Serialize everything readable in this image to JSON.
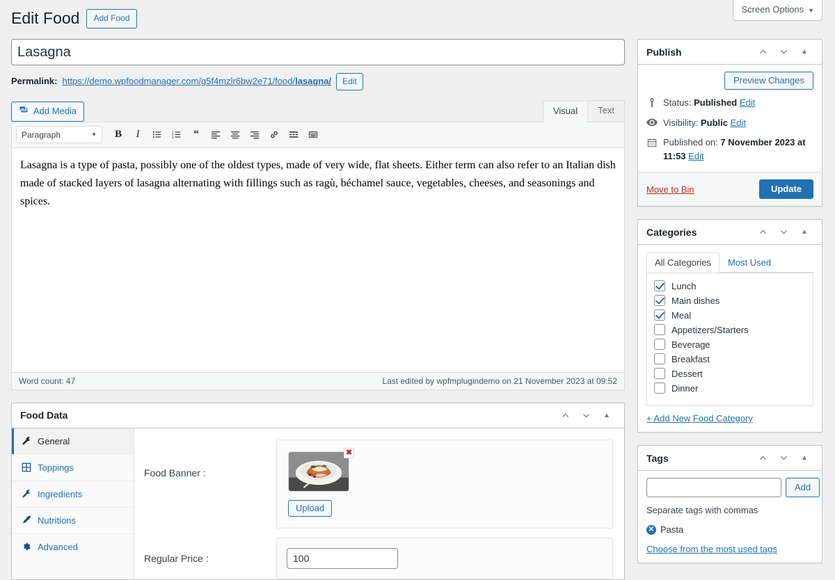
{
  "screen_meta": {
    "screen_options_label": "Screen Options",
    "caret": "▼"
  },
  "header": {
    "page_title": "Edit Food",
    "add_new_label": "Add Food"
  },
  "post": {
    "title_value": "Lasagna",
    "title_placeholder": "Add title",
    "permalink_label": "Permalink:",
    "permalink_base": "https://demo.wpfoodmanager.com/g5f4mzlr6bw2e71/food/",
    "permalink_slug": "lasagna/",
    "permalink_edit_label": "Edit"
  },
  "editor": {
    "add_media_label": "Add Media",
    "tabs": [
      {
        "label": "Visual",
        "active": true
      },
      {
        "label": "Text",
        "active": false
      }
    ],
    "format_select": "Paragraph",
    "toolbar_icons": [
      "bold-icon",
      "italic-icon",
      "bulleted-list-icon",
      "numbered-list-icon",
      "blockquote-icon",
      "align-left-icon",
      "align-center-icon",
      "align-right-icon",
      "link-icon",
      "read-more-icon",
      "toolbar-toggle-icon"
    ],
    "content_paragraph": "Lasagna is a type of pasta, possibly one of the oldest types, made of very wide, flat sheets. Either term can also refer to an Italian dish made of stacked layers of lasagna alternating with fillings such as ragù, béchamel sauce, vegetables, cheeses, and seasonings and spices.",
    "word_count": "Word count: 47",
    "last_edited": "Last edited by wpfmplugindemo on 21 November 2023 at 09:52"
  },
  "food_data": {
    "panel_title": "Food Data",
    "tabs": [
      {
        "label": "General",
        "icon": "wrench-icon",
        "active": true
      },
      {
        "label": "Toppings",
        "icon": "grid-icon",
        "active": false
      },
      {
        "label": "Ingredients",
        "icon": "wrench-icon",
        "active": false
      },
      {
        "label": "Nutritions",
        "icon": "syringe-icon",
        "active": false
      },
      {
        "label": "Advanced",
        "icon": "gear-icon",
        "active": false
      }
    ],
    "banner_label": "Food Banner :",
    "banner_remove_glyph": "✖",
    "upload_label": "Upload",
    "price_label": "Regular Price :",
    "price_value": "100"
  },
  "publish": {
    "panel_title": "Publish",
    "preview_label": "Preview Changes",
    "status_label": "Status:",
    "status_value": "Published",
    "status_edit": "Edit",
    "visibility_label": "Visibility:",
    "visibility_value": "Public",
    "visibility_edit": "Edit",
    "published_label": "Published on:",
    "published_value": "7 November 2023 at 11:53",
    "published_edit": "Edit",
    "trash_label": "Move to Bin",
    "update_label": "Update"
  },
  "categories": {
    "panel_title": "Categories",
    "tabs": [
      {
        "label": "All Categories",
        "active": true
      },
      {
        "label": "Most Used",
        "active": false
      }
    ],
    "items": [
      {
        "label": "Lunch",
        "checked": true
      },
      {
        "label": "Main dishes",
        "checked": true
      },
      {
        "label": "Meal",
        "checked": true
      },
      {
        "label": "Appetizers/Starters",
        "checked": false
      },
      {
        "label": "Beverage",
        "checked": false
      },
      {
        "label": "Breakfast",
        "checked": false
      },
      {
        "label": "Dessert",
        "checked": false
      },
      {
        "label": "Dinner",
        "checked": false
      }
    ],
    "add_new_label": "+ Add New Food Category"
  },
  "tags": {
    "panel_title": "Tags",
    "input_value": "",
    "input_placeholder": "",
    "add_label": "Add",
    "hint": "Separate tags with commas",
    "chips": [
      {
        "label": "Pasta",
        "remove_glyph": "✕"
      }
    ],
    "most_used_label": "Choose from the most used tags"
  },
  "colors": {
    "accent": "#2271b1",
    "danger": "#b32d2e",
    "page_bg": "#f0f0f1",
    "panel_border": "#c3c4c7"
  }
}
